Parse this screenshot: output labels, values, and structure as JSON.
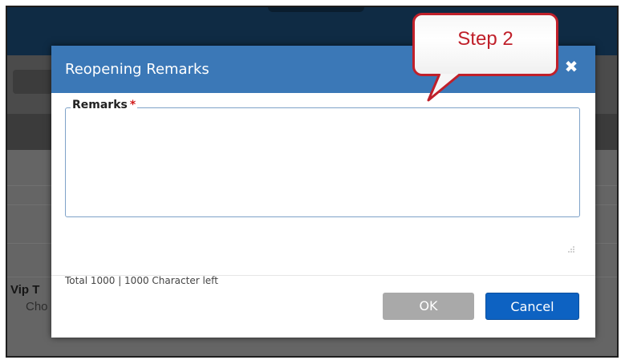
{
  "background_app": {
    "field_label": "Vip T",
    "field_value": "Cho"
  },
  "dialog": {
    "title": "Reopening Remarks",
    "close_icon": "close-icon",
    "remarks": {
      "label": "Remarks",
      "required_marker": "*",
      "value": "",
      "counter_text": "Total 1000 | 1000 Character left"
    },
    "buttons": {
      "ok_label": "OK",
      "cancel_label": "Cancel"
    }
  },
  "callout": {
    "text": "Step 2"
  },
  "colors": {
    "header_blue": "#3b78b7",
    "cancel_blue": "#0d62c2",
    "ok_gray": "#a9a9a9",
    "callout_red": "#c0202a",
    "required_red": "#d11a1a"
  }
}
